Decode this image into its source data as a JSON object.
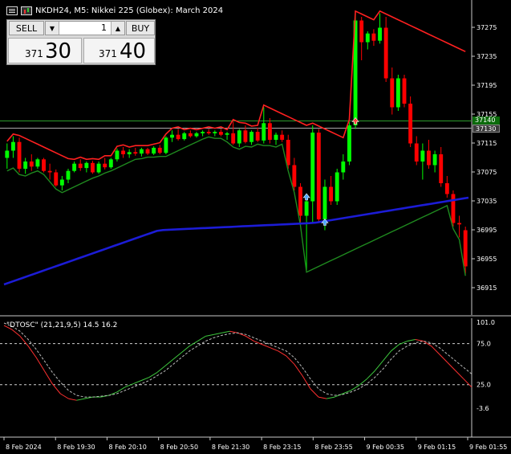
{
  "header": {
    "title": "NKDH24, M5:  Nikkei 225 (Globex): March 2024"
  },
  "trade_panel": {
    "sell_label": "SELL",
    "buy_label": "BUY",
    "lot_value": "1",
    "sell_price_small": "371",
    "sell_price_big": "30",
    "buy_price_small": "371",
    "buy_price_big": "40"
  },
  "price_tags": {
    "green": "37140",
    "gray": "37130"
  },
  "oscillator": {
    "label": "\"DTOSC\" (21,21,9,5) 14.5 16.2"
  },
  "colors": {
    "bull": "#00ff00",
    "bear": "#ff0000",
    "ma": "#1c1cd6",
    "band_red": "#ff2020",
    "band_green": "#1f8a1f",
    "osc_fast": "#ff3030",
    "osc_slow": "#3ec83e"
  },
  "chart_data": [
    {
      "type": "candlestick",
      "title": "NKDH24, M5:  Nikkei 225 (Globex): March 2024",
      "ylim": [
        36895,
        37295
      ],
      "y_ticks": [
        "37275",
        "37235",
        "37195",
        "37155",
        "37115",
        "37075",
        "37035",
        "36995",
        "36955",
        "36915"
      ],
      "x_ticks": [
        "8 Feb 2024",
        "8 Feb 19:30",
        "8 Feb 20:10",
        "8 Feb 20:50",
        "8 Feb 21:30",
        "8 Feb 23:15",
        "8 Feb 23:55",
        "9 Feb 00:35",
        "9 Feb 01:15",
        "9 Feb 01:55"
      ],
      "current_price_lines": [
        37140,
        37130
      ],
      "candles": [
        {
          "o": 37090,
          "h": 37110,
          "l": 37075,
          "c": 37100
        },
        {
          "o": 37100,
          "h": 37120,
          "l": 37090,
          "c": 37112
        },
        {
          "o": 37112,
          "h": 37118,
          "l": 37070,
          "c": 37075
        },
        {
          "o": 37075,
          "h": 37090,
          "l": 37068,
          "c": 37085
        },
        {
          "o": 37085,
          "h": 37095,
          "l": 37072,
          "c": 37078
        },
        {
          "o": 37078,
          "h": 37090,
          "l": 37075,
          "c": 37088
        },
        {
          "o": 37088,
          "h": 37090,
          "l": 37070,
          "c": 37072
        },
        {
          "o": 37072,
          "h": 37082,
          "l": 37060,
          "c": 37070
        },
        {
          "o": 37070,
          "h": 37074,
          "l": 37050,
          "c": 37052
        },
        {
          "o": 37052,
          "h": 37065,
          "l": 37045,
          "c": 37060
        },
        {
          "o": 37060,
          "h": 37075,
          "l": 37055,
          "c": 37072
        },
        {
          "o": 37072,
          "h": 37085,
          "l": 37070,
          "c": 37082
        },
        {
          "o": 37082,
          "h": 37088,
          "l": 37072,
          "c": 37076
        },
        {
          "o": 37076,
          "h": 37085,
          "l": 37070,
          "c": 37083
        },
        {
          "o": 37083,
          "h": 37086,
          "l": 37068,
          "c": 37070
        },
        {
          "o": 37070,
          "h": 37085,
          "l": 37068,
          "c": 37082
        },
        {
          "o": 37082,
          "h": 37090,
          "l": 37074,
          "c": 37077
        },
        {
          "o": 37077,
          "h": 37090,
          "l": 37075,
          "c": 37088
        },
        {
          "o": 37088,
          "h": 37103,
          "l": 37085,
          "c": 37100
        },
        {
          "o": 37100,
          "h": 37105,
          "l": 37090,
          "c": 37095
        },
        {
          "o": 37095,
          "h": 37102,
          "l": 37090,
          "c": 37098
        },
        {
          "o": 37098,
          "h": 37104,
          "l": 37093,
          "c": 37096
        },
        {
          "o": 37096,
          "h": 37104,
          "l": 37092,
          "c": 37102
        },
        {
          "o": 37102,
          "h": 37104,
          "l": 37094,
          "c": 37096
        },
        {
          "o": 37096,
          "h": 37106,
          "l": 37094,
          "c": 37104
        },
        {
          "o": 37104,
          "h": 37108,
          "l": 37095,
          "c": 37097
        },
        {
          "o": 37097,
          "h": 37120,
          "l": 37095,
          "c": 37118
        },
        {
          "o": 37118,
          "h": 37128,
          "l": 37112,
          "c": 37122
        },
        {
          "o": 37122,
          "h": 37130,
          "l": 37114,
          "c": 37116
        },
        {
          "o": 37116,
          "h": 37126,
          "l": 37114,
          "c": 37124
        },
        {
          "o": 37124,
          "h": 37128,
          "l": 37118,
          "c": 37120
        },
        {
          "o": 37120,
          "h": 37126,
          "l": 37118,
          "c": 37124
        },
        {
          "o": 37124,
          "h": 37128,
          "l": 37120,
          "c": 37126
        },
        {
          "o": 37126,
          "h": 37130,
          "l": 37122,
          "c": 37124
        },
        {
          "o": 37124,
          "h": 37128,
          "l": 37120,
          "c": 37126
        },
        {
          "o": 37126,
          "h": 37130,
          "l": 37120,
          "c": 37122
        },
        {
          "o": 37122,
          "h": 37126,
          "l": 37115,
          "c": 37124
        },
        {
          "o": 37124,
          "h": 37140,
          "l": 37108,
          "c": 37110
        },
        {
          "o": 37110,
          "h": 37130,
          "l": 37105,
          "c": 37128
        },
        {
          "o": 37128,
          "h": 37135,
          "l": 37110,
          "c": 37112
        },
        {
          "o": 37112,
          "h": 37128,
          "l": 37108,
          "c": 37126
        },
        {
          "o": 37126,
          "h": 37132,
          "l": 37112,
          "c": 37114
        },
        {
          "o": 37114,
          "h": 37160,
          "l": 37110,
          "c": 37138
        },
        {
          "o": 37138,
          "h": 37145,
          "l": 37110,
          "c": 37115
        },
        {
          "o": 37115,
          "h": 37125,
          "l": 37108,
          "c": 37122
        },
        {
          "o": 37122,
          "h": 37128,
          "l": 37112,
          "c": 37115
        },
        {
          "o": 37115,
          "h": 37122,
          "l": 37075,
          "c": 37080
        },
        {
          "o": 37080,
          "h": 37090,
          "l": 37045,
          "c": 37050
        },
        {
          "o": 37050,
          "h": 37055,
          "l": 37000,
          "c": 37010
        },
        {
          "o": 37010,
          "h": 37040,
          "l": 36935,
          "c": 37030
        },
        {
          "o": 37030,
          "h": 37135,
          "l": 37000,
          "c": 37125
        },
        {
          "o": 37125,
          "h": 37130,
          "l": 37000,
          "c": 37005
        },
        {
          "o": 37005,
          "h": 37060,
          "l": 36990,
          "c": 37050
        },
        {
          "o": 37050,
          "h": 37065,
          "l": 37025,
          "c": 37030
        },
        {
          "o": 37030,
          "h": 37075,
          "l": 37025,
          "c": 37070
        },
        {
          "o": 37070,
          "h": 37095,
          "l": 37060,
          "c": 37085
        },
        {
          "o": 37085,
          "h": 37140,
          "l": 37080,
          "c": 37135
        },
        {
          "o": 37135,
          "h": 37290,
          "l": 37130,
          "c": 37280
        },
        {
          "o": 37280,
          "h": 37285,
          "l": 37225,
          "c": 37250
        },
        {
          "o": 37250,
          "h": 37265,
          "l": 37240,
          "c": 37262
        },
        {
          "o": 37262,
          "h": 37268,
          "l": 37245,
          "c": 37252
        },
        {
          "o": 37252,
          "h": 37290,
          "l": 37248,
          "c": 37270
        },
        {
          "o": 37270,
          "h": 37285,
          "l": 37195,
          "c": 37200
        },
        {
          "o": 37200,
          "h": 37215,
          "l": 37150,
          "c": 37160
        },
        {
          "o": 37160,
          "h": 37205,
          "l": 37155,
          "c": 37200
        },
        {
          "o": 37200,
          "h": 37205,
          "l": 37160,
          "c": 37165
        },
        {
          "o": 37165,
          "h": 37175,
          "l": 37105,
          "c": 37110
        },
        {
          "o": 37110,
          "h": 37120,
          "l": 37080,
          "c": 37085
        },
        {
          "o": 37085,
          "h": 37110,
          "l": 37060,
          "c": 37100
        },
        {
          "o": 37100,
          "h": 37115,
          "l": 37075,
          "c": 37080
        },
        {
          "o": 37080,
          "h": 37100,
          "l": 37070,
          "c": 37095
        },
        {
          "o": 37095,
          "h": 37105,
          "l": 37050,
          "c": 37055
        },
        {
          "o": 37055,
          "h": 37065,
          "l": 37035,
          "c": 37040
        },
        {
          "o": 37040,
          "h": 37045,
          "l": 36995,
          "c": 37000
        },
        {
          "o": 37000,
          "h": 37010,
          "l": 36980,
          "c": 36998
        },
        {
          "o": 36990,
          "h": 36995,
          "l": 36930,
          "c": 36940
        }
      ],
      "moving_average": [
        {
          "x": "start",
          "y": 36915
        },
        {
          "x": "mid",
          "y": 36990
        },
        {
          "x": "9 Feb 00:35",
          "y": 37000
        },
        {
          "x": "end",
          "y": 37035
        }
      ]
    },
    {
      "type": "line",
      "title": "\"DTOSC\" (21,21,9,5) 14.5 16.2",
      "ylim": [
        -3.6,
        101.0
      ],
      "y_ticks": [
        "101.0",
        "75.0",
        "25.0",
        "-3.6"
      ],
      "levels": [
        75.0,
        25.0
      ],
      "series": [
        {
          "values": [
            97,
            92,
            84,
            72,
            58,
            42,
            26,
            14,
            8,
            6,
            8,
            10,
            10,
            12,
            16,
            22,
            26,
            30,
            34,
            40,
            48,
            56,
            64,
            72,
            78,
            84,
            86,
            88,
            90,
            88,
            84,
            78,
            74,
            70,
            66,
            60,
            50,
            36,
            20,
            10,
            8,
            10,
            14,
            18,
            24,
            32,
            42,
            54,
            66,
            74,
            78,
            80,
            78,
            72,
            62,
            52,
            42,
            32,
            22
          ]
        },
        {
          "values": [
            100,
            96,
            90,
            80,
            68,
            54,
            40,
            28,
            18,
            12,
            10,
            10,
            11,
            12,
            14,
            18,
            22,
            26,
            30,
            36,
            42,
            50,
            58,
            66,
            72,
            78,
            82,
            85,
            87,
            88,
            86,
            82,
            78,
            74,
            70,
            66,
            58,
            46,
            32,
            20,
            14,
            12,
            13,
            16,
            20,
            26,
            34,
            44,
            56,
            66,
            72,
            76,
            78,
            76,
            70,
            62,
            54,
            46,
            38
          ]
        }
      ],
      "last_values": [
        14.5,
        16.2
      ]
    }
  ]
}
